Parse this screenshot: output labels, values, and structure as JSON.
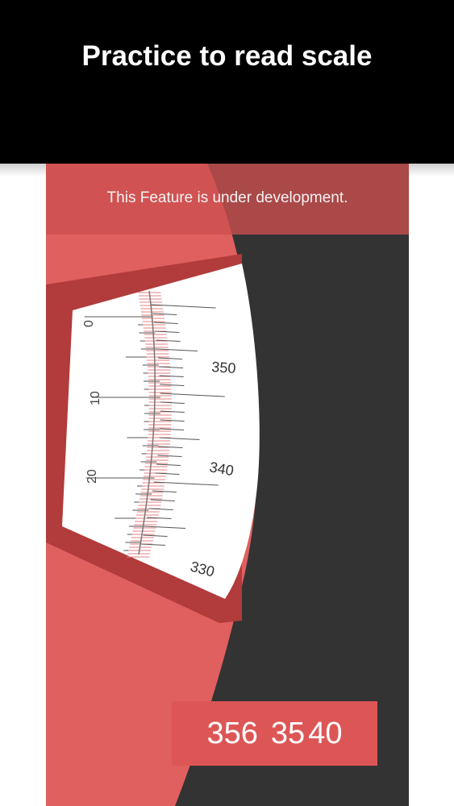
{
  "header": {
    "title": "Practice to read scale"
  },
  "notice": {
    "text": "This Feature is under development."
  },
  "scale": {
    "main_labels": [
      "0",
      "10",
      "20"
    ],
    "vernier_labels": [
      "350",
      "340",
      "330"
    ]
  },
  "reading": {
    "degrees": "356",
    "minutes": "35",
    "seconds": "40"
  },
  "colors": {
    "primary_red": "#e05f5f",
    "dark_red": "#b23b3b",
    "background_dark": "#333333",
    "banner": "#000000"
  }
}
